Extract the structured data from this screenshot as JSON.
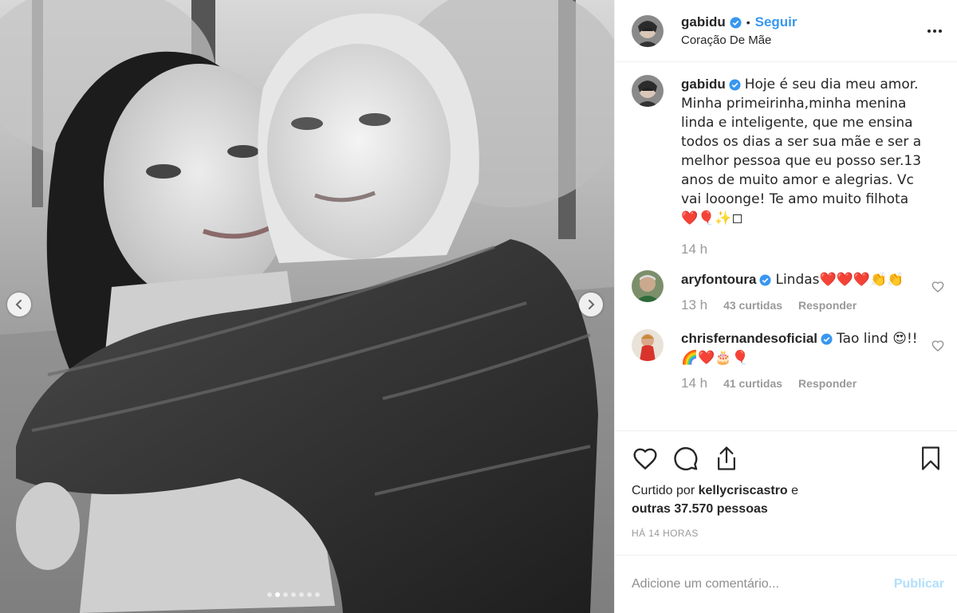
{
  "post": {
    "author": "gabidu",
    "follow_label": "Seguir",
    "separator": "•",
    "location": "Coração De Mãe",
    "more_icon": "more-horizontal-icon"
  },
  "caption": {
    "username": "gabidu",
    "text": "Hoje é seu dia meu amor. Minha primeirinha,minha menina linda e inteligente, que me ensina todos os dias a ser sua mãe e ser a melhor pessoa que eu posso ser.13 anos de muito amor e alegrias. Vc vai looonge! Te amo muito filhota ❤️🎈✨◻",
    "time": "14 h"
  },
  "comments": [
    {
      "username": "aryfontoura",
      "text": "Lindas❤️❤️❤️👏👏",
      "time": "13 h",
      "likes": "43 curtidas",
      "reply_label": "Responder"
    },
    {
      "username": "chrisfernandesoficial",
      "text": "Tao lind 😍!! 🌈❤️🎂🎈",
      "time": "14 h",
      "likes": "41 curtidas",
      "reply_label": "Responder"
    }
  ],
  "likes": {
    "prefix": "Curtido por",
    "user": "kellycriscastro",
    "conjunction": "e",
    "others": "outras 37.570 pessoas"
  },
  "timestamp": "HÁ 14 HORAS",
  "add_comment": {
    "placeholder": "Adicione um comentário...",
    "publish_label": "Publicar"
  },
  "colors": {
    "link_blue": "#3897f0",
    "publish_disabled": "#b2dffc",
    "secondary_text": "#999999",
    "verified_blue": "#3897f0"
  },
  "carousel": {
    "total": 7,
    "active_index": 1
  }
}
